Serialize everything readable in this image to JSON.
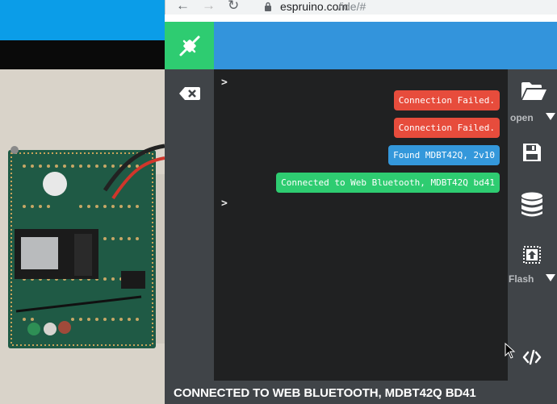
{
  "browser": {
    "url_host": "espruino.com",
    "url_path": "/ide/#"
  },
  "terminal": {
    "prompts": [
      ">",
      ">"
    ],
    "messages": [
      {
        "text": "Connection Failed.",
        "kind": "error"
      },
      {
        "text": "Connection Failed.",
        "kind": "error"
      },
      {
        "text": "Found MDBT42Q, 2v10",
        "kind": "info"
      },
      {
        "text": "Connected to Web Bluetooth, MDBT42Q bd41",
        "kind": "success"
      }
    ]
  },
  "toolbar": {
    "open_label": "open",
    "flash_label": "Flash"
  },
  "status": {
    "text": "CONNECTED TO WEB BLUETOOTH, MDBT42Q BD41"
  },
  "colors": {
    "connect_green": "#2ecc71",
    "topbar_blue": "#3394dc",
    "error_red": "#e74c3c",
    "info_blue": "#3498db",
    "toolbar_gray": "#404448",
    "terminal_bg": "#202122"
  },
  "icons": {
    "connect": "plug-connected-icon",
    "clear": "backspace-icon",
    "open": "folder-open-icon",
    "save": "floppy-disk-icon",
    "storage": "database-icon",
    "flash": "upload-chip-icon",
    "code": "code-icon"
  }
}
